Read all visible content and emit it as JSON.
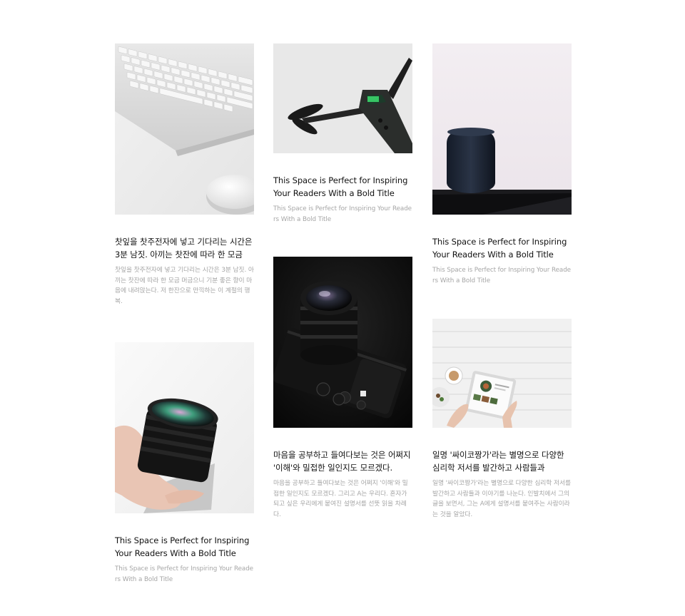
{
  "cards": [
    {
      "id": "keyboard",
      "image_alt": "keyboard-and-mouse",
      "title": "찻잎을 찻주전자에 넣고 기다리는 시간은 3분 남짓. 아끼는 찻잔에 따라 한 모금",
      "description": "찻잎을 찻주전자에 넣고 기다리는 시간은 3분 남짓. 아끼는 찻잔에 따라 한 모금 머금으니 기분 좋은 향이 마음에 내려앉는다. 저 한잔으로 만끽하는 이 계절의 행복."
    },
    {
      "id": "lens",
      "image_alt": "hand-holding-camera-lens",
      "title": "This Space is Perfect for Inspiring Your Readers With a Bold Title",
      "description": "This Space is Perfect for Inspiring Your Readers With a Bold Title"
    },
    {
      "id": "drone",
      "image_alt": "drone",
      "title": "This Space is Perfect for Inspiring Your Readers With a Bold Title",
      "description": "This Space is Perfect for Inspiring Your Readers With a Bold Title"
    },
    {
      "id": "camera",
      "image_alt": "camera-on-dark-background",
      "title": "마음을 공부하고 들여다보는 것은 어쩌지 '이해'와 밀접한 일인지도 모르겠다.",
      "description": "마음을 공부하고 들여다보는 것은 어쩌지 '이해'와 밀접한 일인지도 모르겠다. 그리고 A는 우리다. 혼자가 되고 싶은 우리에게 붙여진 설명서를 선뜻 읽을 차례다."
    },
    {
      "id": "speaker",
      "image_alt": "smart-speaker",
      "title": "This Space is Perfect for Inspiring Your Readers With a Bold Title",
      "description": "This Space is Perfect for Inspiring Your Readers With a Bold Title"
    },
    {
      "id": "tablet",
      "image_alt": "tablet-on-wooden-table",
      "title": "일명 '싸이코짱가'라는 별명으로 다양한 심리학 저서를 발간하고 사람들과",
      "description": "일명 '싸이코짱가'라는 별명으로 다양한 심리학 저서를 발간하고 사람들과 이야기를 나눈다. 인발치에서 그의 글을 보면서, 그는 A에게 설명서를 붙여주는 사람이라는 것을 알았다."
    }
  ]
}
